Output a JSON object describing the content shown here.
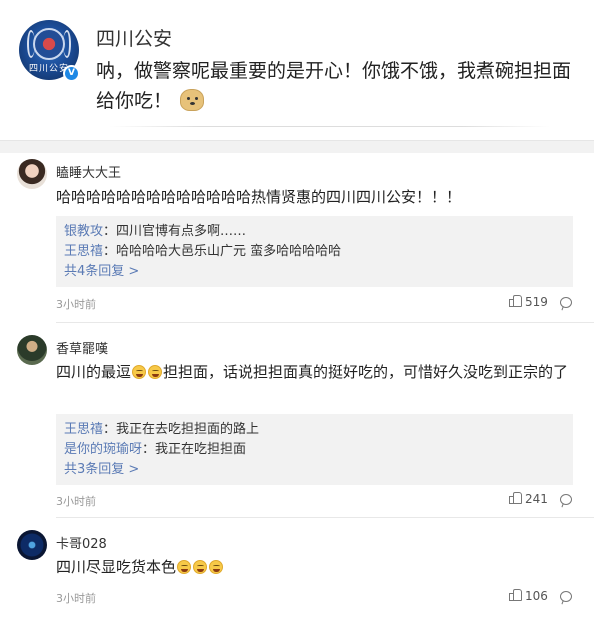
{
  "post": {
    "author": "四川公安",
    "avatar_text": "四川公安",
    "text": "呐，做警察呢最重要的是开心！你饿不饿，我煮碗担担面给你吃！",
    "emoji": "doge-icon"
  },
  "comments": [
    {
      "name": "瞌睡大大王",
      "text": "哈哈哈哈哈哈哈哈哈哈哈哈哈热情贤惠的四川四川公安！！！",
      "replies": [
        {
          "user": "银教攻",
          "text": "：四川官博有点多啊……"
        },
        {
          "user": "王思禧",
          "text": "：哈哈哈哈大邑乐山广元 蛮多哈哈哈哈哈"
        }
      ],
      "more": "共4条回复 >",
      "time": "3小时前",
      "likes": "519"
    },
    {
      "name": "香草罷嘆",
      "text_before": "四川的最逗",
      "text_after": "担担面，话说担担面真的挺好吃的，可惜好久没吃到正宗的了",
      "replies": [
        {
          "user": "王思禧",
          "text": "：我正在去吃担担面的路上"
        },
        {
          "user": "是你的琬瑜呀",
          "text": "：我正在吃担担面"
        }
      ],
      "more": "共3条回复 >",
      "time": "3小时前",
      "likes": "241"
    },
    {
      "name": "卡哥028",
      "text": "四川尽显吃货本色",
      "time": "3小时前",
      "likes": "106"
    }
  ]
}
